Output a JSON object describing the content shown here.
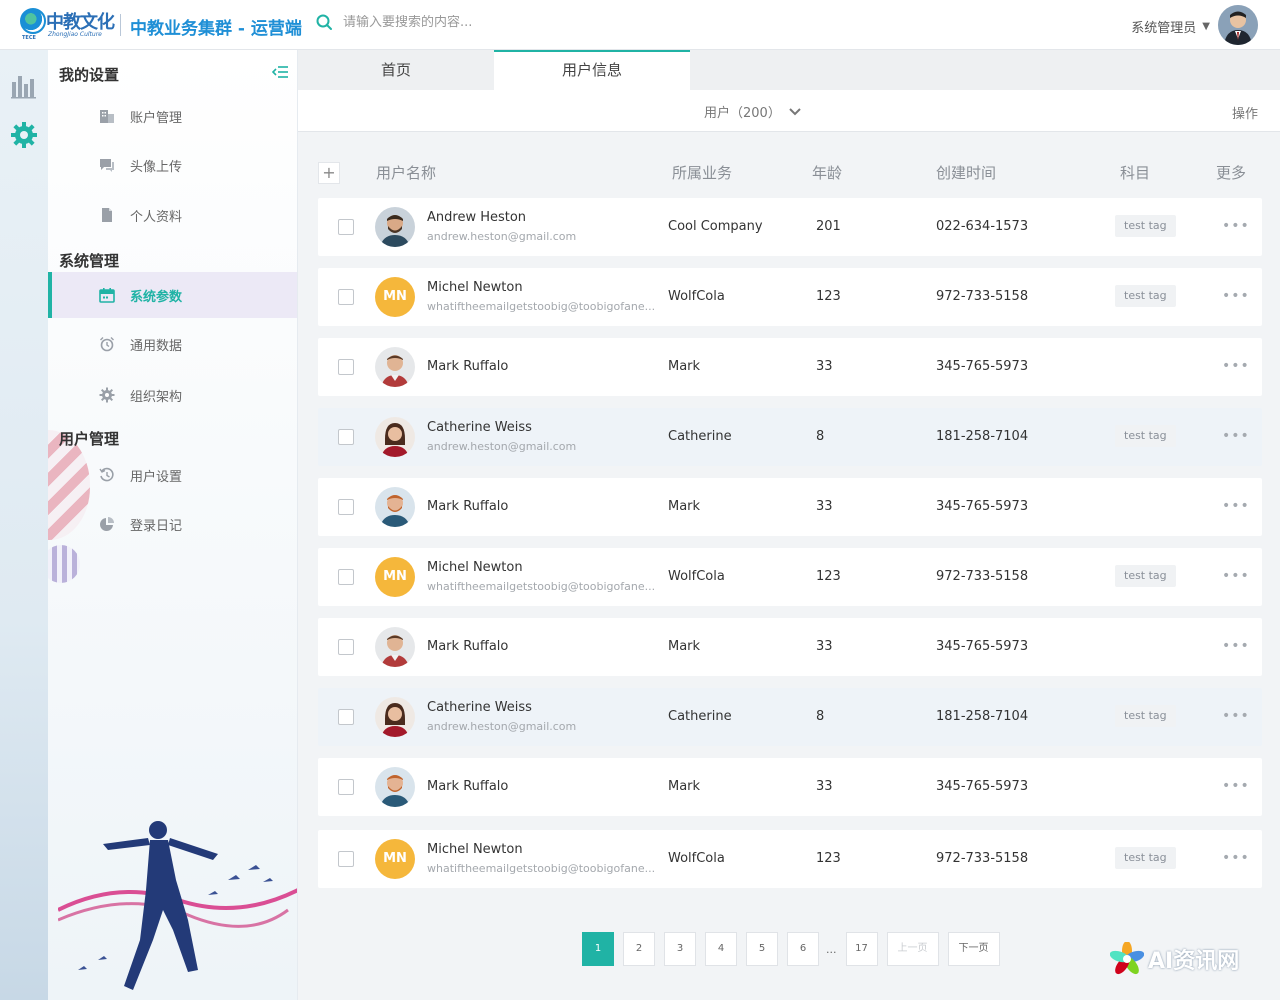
{
  "header": {
    "logo_text": "中教文化",
    "logo_sub": "ZhongJiao Culture",
    "logo_sub2": "TECE",
    "app_title": "中教业务集群 - 运营端",
    "search_placeholder": "请输入要搜索的内容...",
    "user_label": "系统管理员",
    "caret": "▼"
  },
  "sidebar": {
    "sections": [
      {
        "title": "我的设置",
        "items": [
          {
            "label": "账户管理",
            "icon": "building-icon"
          },
          {
            "label": "头像上传",
            "icon": "chat-icon"
          },
          {
            "label": "个人资料",
            "icon": "document-icon"
          }
        ]
      },
      {
        "title": "系统管理",
        "items": [
          {
            "label": "系统参数",
            "icon": "calendar-icon",
            "active": true
          },
          {
            "label": "通用数据",
            "icon": "alarm-icon"
          },
          {
            "label": "组织架构",
            "icon": "gear-icon"
          }
        ]
      },
      {
        "title": "用户管理",
        "items": [
          {
            "label": "用户设置",
            "icon": "history-icon"
          },
          {
            "label": "登录日记",
            "icon": "pie-icon"
          }
        ]
      }
    ]
  },
  "tabs": [
    {
      "label": "首页",
      "active": false
    },
    {
      "label": "用户信息",
      "active": true
    }
  ],
  "toolbar": {
    "user_count": "用户（200）",
    "ops": "操作"
  },
  "table": {
    "add": "+",
    "columns": [
      "用户名称",
      "所属业务",
      "年龄",
      "创建时间",
      "科目",
      "更多"
    ],
    "rows": [
      {
        "name": "Andrew Heston",
        "email": "andrew.heston@gmail.com",
        "business": "Cool Company",
        "age": "201",
        "created": "022-634-1573",
        "tag": "test tag",
        "avatar": "photo-a",
        "highlight": false
      },
      {
        "name": "Michel Newton",
        "email": "whatiftheemailgetstoobig@toobigofane...",
        "business": "WolfCola",
        "age": "123",
        "created": "972-733-5158",
        "tag": "test tag",
        "avatar": "MN",
        "highlight": false
      },
      {
        "name": "Mark Ruffalo",
        "email": "",
        "business": "Mark",
        "age": "33",
        "created": "345-765-5973",
        "tag": "",
        "avatar": "photo-b",
        "highlight": false
      },
      {
        "name": "Catherine Weiss",
        "email": "andrew.heston@gmail.com",
        "business": "Catherine",
        "age": "8",
        "created": "181-258-7104",
        "tag": "test tag",
        "avatar": "photo-c",
        "highlight": true
      },
      {
        "name": "Mark Ruffalo",
        "email": "",
        "business": "Mark",
        "age": "33",
        "created": "345-765-5973",
        "tag": "",
        "avatar": "photo-d",
        "highlight": false
      },
      {
        "name": "Michel Newton",
        "email": "whatiftheemailgetstoobig@toobigofane...",
        "business": "WolfCola",
        "age": "123",
        "created": "972-733-5158",
        "tag": "test tag",
        "avatar": "MN",
        "highlight": false
      },
      {
        "name": "Mark Ruffalo",
        "email": "",
        "business": "Mark",
        "age": "33",
        "created": "345-765-5973",
        "tag": "",
        "avatar": "photo-b",
        "highlight": false
      },
      {
        "name": "Catherine Weiss",
        "email": "andrew.heston@gmail.com",
        "business": "Catherine",
        "age": "8",
        "created": "181-258-7104",
        "tag": "test tag",
        "avatar": "photo-c",
        "highlight": true
      },
      {
        "name": "Mark Ruffalo",
        "email": "",
        "business": "Mark",
        "age": "33",
        "created": "345-765-5973",
        "tag": "",
        "avatar": "photo-d",
        "highlight": false
      },
      {
        "name": "Michel Newton",
        "email": "whatiftheemailgetstoobig@toobigofane...",
        "business": "WolfCola",
        "age": "123",
        "created": "972-733-5158",
        "tag": "test tag",
        "avatar": "MN",
        "highlight": false
      }
    ],
    "more_glyph": "•••"
  },
  "pagination": {
    "pages": [
      "1",
      "2",
      "3",
      "4",
      "5",
      "6"
    ],
    "ellipsis": "...",
    "last": "17",
    "prev": "上一页",
    "next": "下一页",
    "current": "1"
  },
  "watermark": "AI资讯网",
  "colors": {
    "accent": "#20b3a5",
    "brand": "#1f8fd6",
    "avatar_initials": "#f5b73b"
  }
}
